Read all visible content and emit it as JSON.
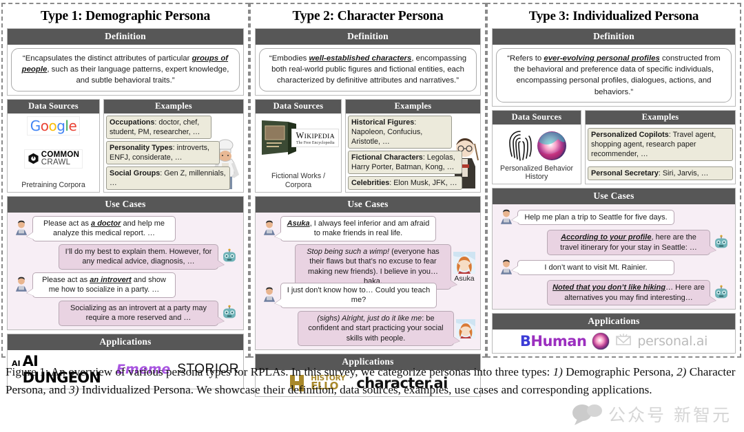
{
  "columns": [
    {
      "title": "Type 1: Demographic Persona",
      "definition_header": "Definition",
      "definition": {
        "pre": "“Encapsulates the distinct attributes of particular ",
        "em": "groups of people",
        "post": ", such as their language patterns, expert knowledge, and subtle behavioral traits.”"
      },
      "data_sources_header": "Data Sources",
      "data_sources_caption": "Pretraining Corpora",
      "examples_header": "Examples",
      "examples": [
        {
          "label": "Occupations",
          "text": ": doctor, chef, student, PM, researcher, …"
        },
        {
          "label": "Personality Types",
          "text": ": introverts, ENFJ, considerate, …"
        },
        {
          "label": "Social Groups",
          "text": ": Gen Z, millennials, …"
        }
      ],
      "use_cases_header": "Use Cases",
      "use_cases": [
        {
          "speaker": "user",
          "pre": "Please act as ",
          "em": "a doctor",
          "post": " and help me analyze this medical report. …"
        },
        {
          "speaker": "bot",
          "pre": "I’ll do my best to explain them. However, for any medical advice, diagnosis, …",
          "em": "",
          "post": ""
        },
        {
          "speaker": "user",
          "pre": "Please act as ",
          "em": "an introvert",
          "post": " and show me how to socialize in a party. …"
        },
        {
          "speaker": "bot",
          "pre": "Socializing as an introvert at a party may require a more reserved and …",
          "em": "",
          "post": ""
        }
      ],
      "applications_header": "Applications",
      "applications": [
        "AI DUNGEON",
        "Ememe",
        "STORIOR"
      ]
    },
    {
      "title": "Type 2: Character Persona",
      "definition_header": "Definition",
      "definition": {
        "pre": "“Embodies ",
        "em": "well-established characters",
        "post": ", encompassing both real-world public figures and fictional entities, each characterized by definitive attributes and narratives.”"
      },
      "data_sources_header": "Data Sources",
      "data_sources_caption": "Fictional Works / Corpora",
      "examples_header": "Examples",
      "examples": [
        {
          "label": "Historical Figures",
          "text": ": Napoleon, Confucius, Aristotle, …"
        },
        {
          "label": "Fictional Characters",
          "text": ": Legolas, Harry Porter, Batman, Kong, …"
        },
        {
          "label": "Celebrities",
          "text": ": Elon Musk, JFK, …"
        }
      ],
      "use_cases_header": "Use Cases",
      "use_cases": [
        {
          "speaker": "user",
          "pre": "",
          "em": "Asuka",
          "post": ", I always feel inferior and am afraid to make friends in real life."
        },
        {
          "speaker": "bot",
          "pre": "",
          "em": "Stop being such a wimp!",
          "post": " (everyone has their flaws but that’s no excuse to fear making new friends). I believe in you… baka."
        },
        {
          "speaker": "user",
          "pre": "I just don't know how to… Could you teach me?",
          "em": "",
          "post": ""
        },
        {
          "speaker": "bot",
          "pre": "",
          "em": "(sighs) Alright, just do it like me",
          "post": ": be confident and start practicing your social skills with people."
        }
      ],
      "character_label": "Asuka",
      "applications_header": "Applications",
      "applications": [
        "HISTORY HELLO",
        "character.ai"
      ]
    },
    {
      "title": "Type 3: Individualized Persona",
      "definition_header": "Definition",
      "definition": {
        "pre": "“Refers to ",
        "em": "ever-evolving personal profiles",
        "post": " constructed from the behavioral and preference data of specific individuals, encompassing personal profiles, dialogues, actions, and behaviors.”"
      },
      "data_sources_header": "Data Sources",
      "data_sources_caption": "Personalized Behavior History",
      "examples_header": "Examples",
      "examples": [
        {
          "label": "Personalized Copilots",
          "text": ": Travel agent, shopping agent, research paper recommender, …"
        },
        {
          "label": "Personal Secretary",
          "text": ": Siri, Jarvis, …"
        }
      ],
      "use_cases_header": "Use Cases",
      "use_cases": [
        {
          "speaker": "user",
          "pre": "Help me plan a trip to Seattle for five days.",
          "em": "",
          "post": ""
        },
        {
          "speaker": "bot",
          "pre": "",
          "em": "According to your profile",
          "post": ", here are the travel itinerary for your stay in Seattle: …"
        },
        {
          "speaker": "user",
          "pre": "I don’t want to visit Mt. Rainier.",
          "em": "",
          "post": ""
        },
        {
          "speaker": "bot",
          "pre": "",
          "em": "Noted that you don’t like hiking",
          "post": "… Here are alternatives you may find interesting…"
        }
      ],
      "applications_header": "Applications",
      "applications": [
        "BHuman",
        "personal.ai"
      ]
    }
  ],
  "caption": {
    "p1": "Figure 1: An overview of various persona types for RPLAs. In this survey, we categorize personas into three types: ",
    "n1": "1)",
    "t1": " Demographic Persona, ",
    "n2": "2)",
    "t2": " Character Persona, and ",
    "n3": "3)",
    "t3": " Individualized Persona. We showcase their definition, data sources, examples, use cases and corresponding applications."
  },
  "watermark": {
    "text": "公众号 新智元"
  },
  "colors": {
    "header_bar": "#575757",
    "use_case_bg": "#f7eef5",
    "bot_bubble": "#e9d3e2",
    "example_box": "#eceadb",
    "dashed_border": "#8a8a8a"
  }
}
